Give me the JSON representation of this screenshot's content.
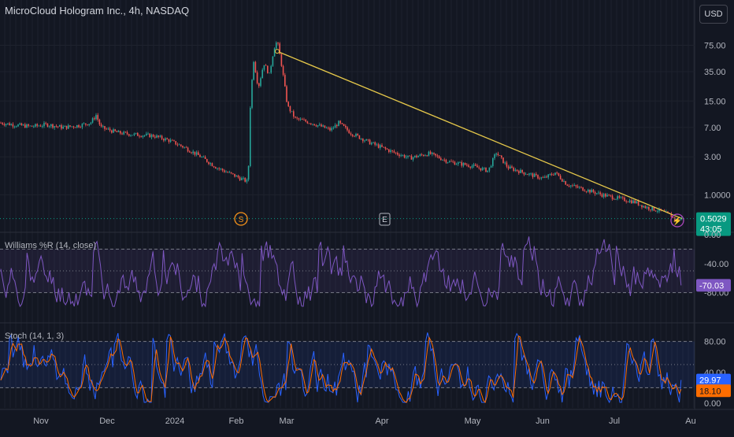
{
  "header": {
    "title": "MicroCloud Hologram Inc., 4h, NASDAQ"
  },
  "currency_button": "USD",
  "price_axis": {
    "ticks": [
      "75.00",
      "35.00",
      "15.00",
      "7.00",
      "3.00",
      "1.0000"
    ],
    "last_price": "0.5029",
    "countdown": "43:05",
    "last_price_color": "#089981"
  },
  "time_axis": {
    "ticks": [
      "Nov",
      "Dec",
      "2024",
      "Feb",
      "Mar",
      "Apr",
      "May",
      "Jun",
      "Jul",
      "Au"
    ]
  },
  "markers": {
    "split": "S",
    "earnings": "E",
    "flash": "⚡"
  },
  "williams": {
    "title": "Williams %R (14, close)",
    "ticks": [
      "0.00",
      "-40.00",
      "-80.00"
    ],
    "last_value": "-70.03",
    "color": "#7e57c2"
  },
  "stoch": {
    "title": "Stoch (14, 1, 3)",
    "ticks": [
      "80.00",
      "40.00",
      "0.00"
    ],
    "k_value": "29.97",
    "d_value": "18.10",
    "k_color": "#2962ff",
    "d_color": "#ff6d00"
  },
  "colors": {
    "background": "#131722",
    "up": "#26a69a",
    "down": "#ef5350",
    "trendline": "#e6c84a"
  },
  "chart_data": {
    "type": "candlestick",
    "scale": "log",
    "interval": "4h",
    "x": [
      "Nov",
      "Dec",
      "2024",
      "Feb",
      "Mar",
      "Apr",
      "May",
      "Jun",
      "Jul",
      "Au"
    ],
    "price_path": [
      [
        0,
        8
      ],
      [
        20,
        7.5
      ],
      [
        40,
        7.2
      ],
      [
        60,
        7.6
      ],
      [
        80,
        7.0
      ],
      [
        100,
        7.4
      ],
      [
        115,
        8.0
      ],
      [
        122,
        10
      ],
      [
        128,
        7.0
      ],
      [
        150,
        6.0
      ],
      [
        170,
        5.7
      ],
      [
        195,
        5.5
      ],
      [
        215,
        4.8
      ],
      [
        235,
        3.9
      ],
      [
        255,
        3.0
      ],
      [
        275,
        2.2
      ],
      [
        300,
        1.7
      ],
      [
        315,
        1.45
      ],
      [
        318,
        15
      ],
      [
        322,
        50
      ],
      [
        328,
        22
      ],
      [
        335,
        45
      ],
      [
        342,
        32
      ],
      [
        348,
        70
      ],
      [
        352,
        85
      ],
      [
        358,
        40
      ],
      [
        365,
        13
      ],
      [
        375,
        9
      ],
      [
        395,
        8
      ],
      [
        420,
        6.5
      ],
      [
        430,
        8
      ],
      [
        445,
        6
      ],
      [
        470,
        4.5
      ],
      [
        500,
        3.4
      ],
      [
        520,
        2.9
      ],
      [
        545,
        3.3
      ],
      [
        570,
        2.6
      ],
      [
        600,
        2.3
      ],
      [
        620,
        2.0
      ],
      [
        630,
        3.4
      ],
      [
        645,
        2.2
      ],
      [
        665,
        1.9
      ],
      [
        690,
        1.6
      ],
      [
        705,
        1.9
      ],
      [
        720,
        1.35
      ],
      [
        745,
        1.15
      ],
      [
        765,
        1.0
      ],
      [
        790,
        0.88
      ],
      [
        805,
        0.82
      ],
      [
        820,
        0.7
      ],
      [
        840,
        0.62
      ],
      [
        852,
        0.55
      ],
      [
        858,
        0.48
      ],
      [
        866,
        0.5029
      ]
    ],
    "trendline": {
      "from": [
        352,
        63
      ],
      "to": [
        866,
        0.5029
      ]
    },
    "yticks": [
      75,
      35,
      15,
      7,
      3,
      1
    ],
    "last_price": 0.5029,
    "williams_r": {
      "levels": [
        -20,
        -50,
        -80
      ],
      "range": [
        -100,
        0
      ],
      "last": -70.03
    },
    "stochastic": {
      "levels": [
        80,
        50,
        20
      ],
      "range": [
        0,
        100
      ],
      "k_last": 29.97,
      "d_last": 18.1
    }
  }
}
